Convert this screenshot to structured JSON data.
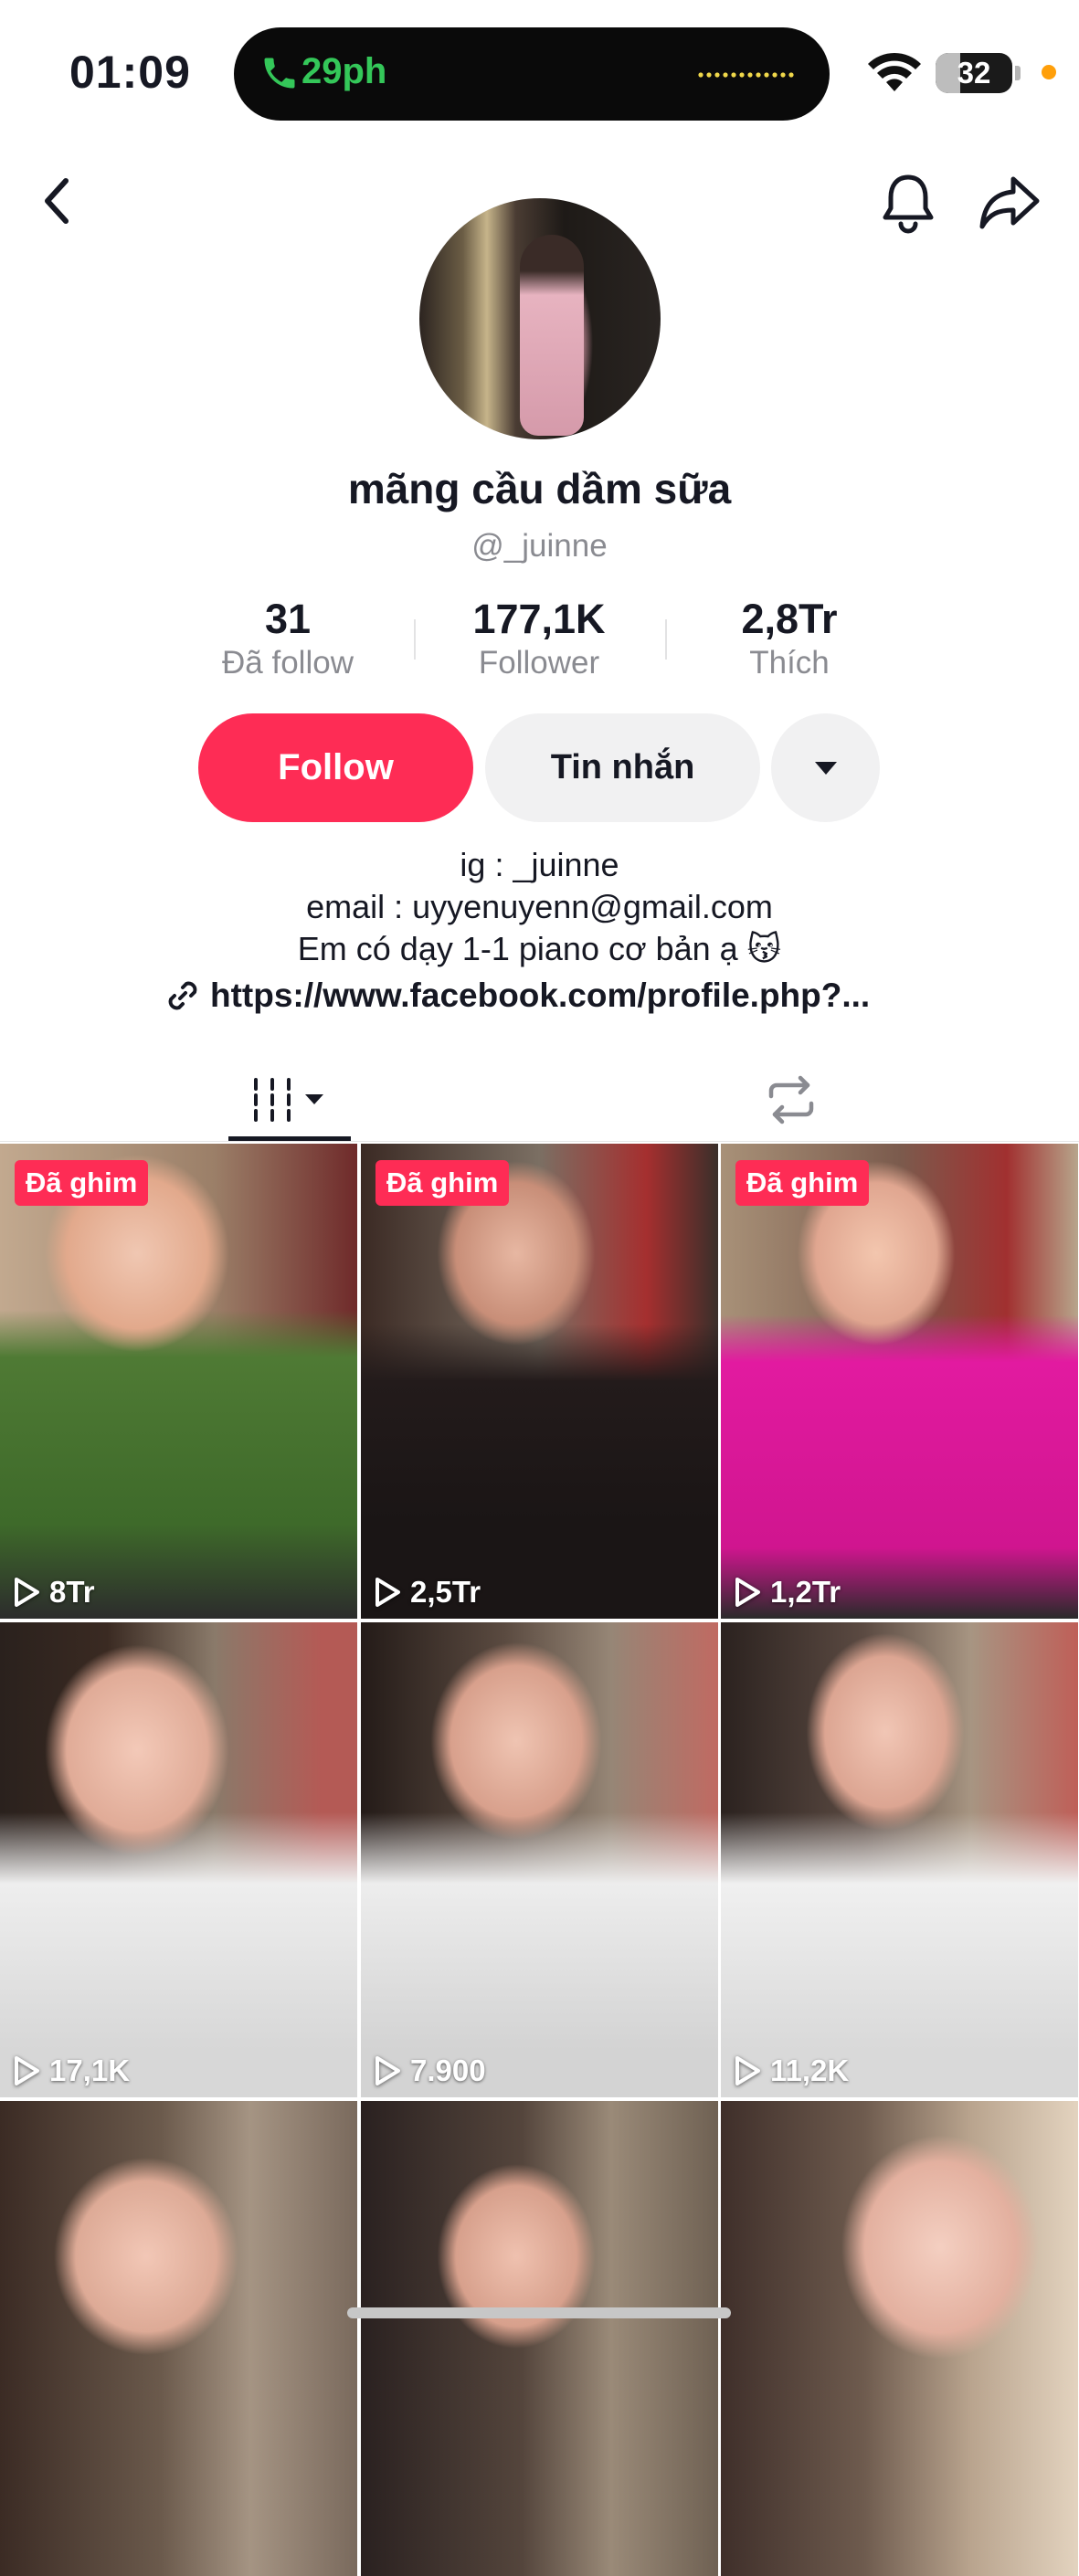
{
  "status_bar": {
    "time": "01:09",
    "call_duration": "29ph",
    "battery_level": "32",
    "battery_fraction": 0.32
  },
  "icons": {
    "back": "chevron-left-icon",
    "bell": "bell-icon",
    "share": "share-arrow-icon",
    "more": "caret-down-icon",
    "link": "link-icon",
    "videos_tab": "grid-bars-icon",
    "reposts_tab": "repost-icon",
    "play": "play-outline-icon"
  },
  "colors": {
    "accent": "#fe2c55",
    "call_green": "#34c759",
    "secondary_text": "#8a8b91",
    "button_grey": "#f1f1f2"
  },
  "profile": {
    "display_name": "mãng cầu dầm sữa",
    "username": "@_juinne",
    "stats": [
      {
        "value": "31",
        "label": "Đã follow"
      },
      {
        "value": "177,1K",
        "label": "Follower"
      },
      {
        "value": "2,8Tr",
        "label": "Thích"
      }
    ],
    "follow_label": "Follow",
    "message_label": "Tin nhắn",
    "bio": {
      "ig": "ig : _juinne",
      "email": "email : uyyenuyenn@gmail.com",
      "tagline": "Em có dạy 1-1 piano cơ bản ạ 😽",
      "link": "https://www.facebook.com/profile.php?..."
    }
  },
  "videos": [
    {
      "views": "8Tr",
      "pinned_label": "Đã ghim"
    },
    {
      "views": "2,5Tr",
      "pinned_label": "Đã ghim"
    },
    {
      "views": "1,2Tr",
      "pinned_label": "Đã ghim"
    },
    {
      "views": "17,1K",
      "pinned_label": ""
    },
    {
      "views": "7.900",
      "pinned_label": ""
    },
    {
      "views": "11,2K",
      "pinned_label": ""
    },
    {
      "views": "",
      "pinned_label": ""
    },
    {
      "views": "",
      "pinned_label": ""
    },
    {
      "views": "",
      "pinned_label": ""
    }
  ]
}
